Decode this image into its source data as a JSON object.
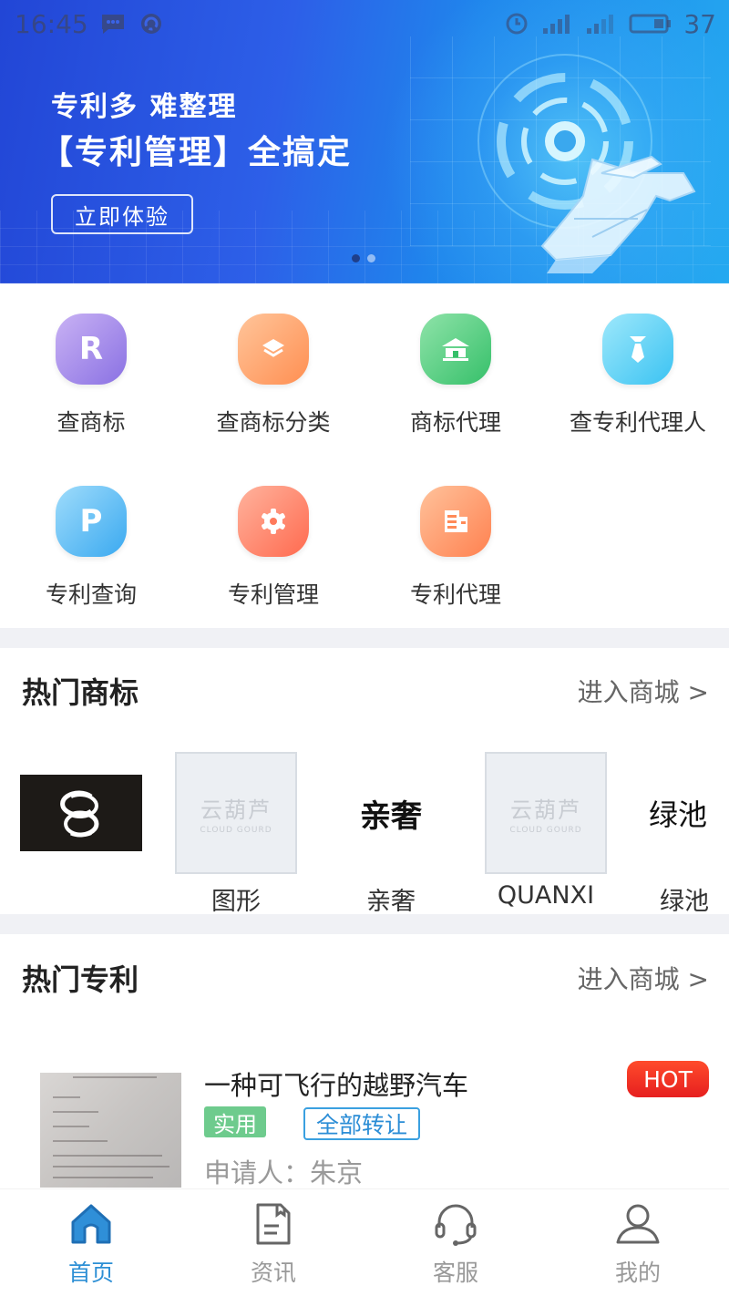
{
  "status_bar": {
    "time": "16:45",
    "battery": "37",
    "icons": [
      "chat-icon",
      "sync-icon",
      "alarm-icon",
      "signal-icon",
      "signal-icon",
      "battery-icon"
    ]
  },
  "banner": {
    "line1": "专利多 难整理",
    "line2": "【专利管理】全搞定",
    "button": "立即体验",
    "slide_count": 2,
    "active_slide": 1
  },
  "services": [
    {
      "label": "查商标",
      "glyph": "R",
      "icon": "trademark-search-icon",
      "color_from": "#c9b2f4",
      "color_to": "#8a71e3"
    },
    {
      "label": "查商标分类",
      "glyph": "",
      "icon": "layers-icon",
      "color_from": "#ffc59a",
      "color_to": "#ff8f52"
    },
    {
      "label": "商标代理",
      "glyph": "",
      "icon": "building-icon",
      "color_from": "#8fe3a9",
      "color_to": "#36c06a"
    },
    {
      "label": "查专利代理人",
      "glyph": "",
      "icon": "agent-icon",
      "color_from": "#9ee8fb",
      "color_to": "#3bc3f2"
    },
    {
      "label": "专利查询",
      "glyph": "P",
      "icon": "patent-search-icon",
      "color_from": "#9fdcfb",
      "color_to": "#3aa9f0"
    },
    {
      "label": "专利管理",
      "glyph": "",
      "icon": "gear-icon",
      "color_from": "#ffb39d",
      "color_to": "#ff6a4f"
    },
    {
      "label": "专利代理",
      "glyph": "",
      "icon": "document-icon",
      "color_from": "#ffc29b",
      "color_to": "#ff8150"
    }
  ],
  "hot_trademarks": {
    "title": "热门商标",
    "more": "进入商城 >",
    "items": [
      {
        "name": "",
        "image": "logo-cc-icon"
      },
      {
        "name": "图形",
        "image": "placeholder",
        "ph_cn": "云葫芦",
        "ph_en": "CLOUD GOURD"
      },
      {
        "name": "亲奢",
        "image": "text",
        "text": "亲奢"
      },
      {
        "name": "QUANXI",
        "image": "placeholder",
        "ph_cn": "云葫芦",
        "ph_en": "CLOUD GOURD"
      },
      {
        "name": "绿池",
        "image": "text",
        "text": "绿池"
      }
    ]
  },
  "hot_patents": {
    "title": "热门专利",
    "more": "进入商城 >",
    "items": [
      {
        "title": "一种可飞行的越野汽车",
        "badge": "HOT",
        "type_tag": "实用",
        "transfer_tag": "全部转让",
        "applicant": "申请人：朱京"
      }
    ]
  },
  "tabbar": [
    {
      "label": "首页",
      "icon": "home-icon",
      "active": true
    },
    {
      "label": "资讯",
      "icon": "news-icon",
      "active": false
    },
    {
      "label": "客服",
      "icon": "headset-icon",
      "active": false
    },
    {
      "label": "我的",
      "icon": "user-icon",
      "active": false
    }
  ]
}
